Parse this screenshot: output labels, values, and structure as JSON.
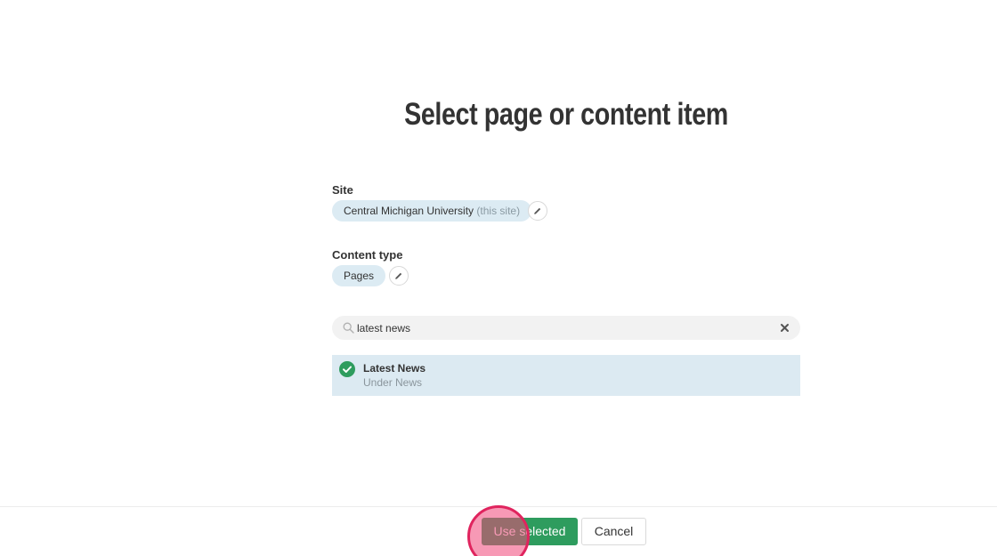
{
  "dialog": {
    "title": "Select page or content item"
  },
  "site": {
    "label": "Site",
    "value": "Central Michigan University",
    "suffix": "(this site)"
  },
  "content_type": {
    "label": "Content type",
    "value": "Pages"
  },
  "search": {
    "value": "latest news",
    "placeholder": ""
  },
  "results": [
    {
      "title": "Latest News",
      "subtitle": "Under News",
      "selected": true
    }
  ],
  "footer": {
    "use_selected_label": "Use selected",
    "cancel_label": "Cancel"
  },
  "icons": {
    "site_edit": "pencil-icon",
    "content_type_edit": "pencil-icon",
    "search": "search-icon",
    "clear": "close-icon",
    "selected": "check-circle-icon"
  },
  "colors": {
    "primary": "#2e9c5e",
    "pill_background": "#dcebf3",
    "selected_row": "#dceaf2",
    "click_indicator": "#e0245e"
  }
}
